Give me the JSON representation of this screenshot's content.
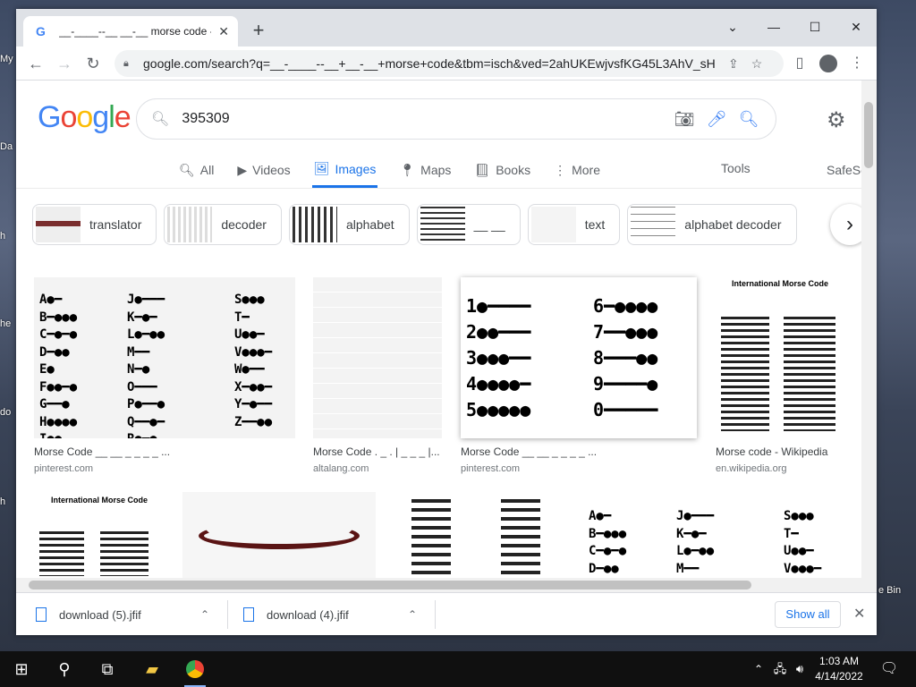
{
  "browser": {
    "tab_title": "__-____--__ __-__ morse code - Go",
    "url": "google.com/search?q=__-____--__+__-__+morse+code&tbm=isch&ved=2ahUKEwjvsfKG45L3AhV_sHIE..."
  },
  "search": {
    "logo": "Google",
    "query": "395309",
    "tabs": [
      "All",
      "Videos",
      "Images",
      "Maps",
      "Books",
      "More"
    ],
    "active_tab": "Images",
    "tools": "Tools",
    "safesearch": "SafeSe"
  },
  "chips": [
    "translator",
    "decoder",
    "alphabet",
    "__ __",
    "text",
    "alphabet decoder"
  ],
  "results": [
    {
      "title": "Morse Code __ __ _ _ _ _ ...",
      "source": "pinterest.com"
    },
    {
      "title": "Morse Code . _ . | _ _ _ |...",
      "source": "altalang.com"
    },
    {
      "title": "Morse Code __ __ _ _ _ _ ...",
      "source": "pinterest.com"
    },
    {
      "title": "Morse code - Wikipedia",
      "source": "en.wikipedia.org"
    }
  ],
  "morse_letters": {
    "col1": [
      "A●━",
      "B━●●●",
      "C━●━●",
      "D━●●",
      "E●",
      "F●●━●",
      "G━━●",
      "H●●●●",
      "I●●"
    ],
    "col2": [
      "J●━━━",
      "K━●━",
      "L●━●●",
      "M━━",
      "N━●",
      "O━━━",
      "P●━━●",
      "Q━━●━",
      "R●━●"
    ],
    "col3": [
      "S●●●",
      "T━",
      "U●●━",
      "V●●●━",
      "W●━━",
      "X━●●━",
      "Y━●━━",
      "Z━━●●"
    ]
  },
  "morse_digits": {
    "left": [
      "1●━━━━",
      "2●●━━━",
      "3●●●━━",
      "4●●●●━",
      "5●●●●●"
    ],
    "right": [
      "6━●●●●",
      "7━━●●●",
      "8━━━●●",
      "9━━━━●",
      "0━━━━━"
    ]
  },
  "wiki_heading": "International Morse Code",
  "downloads": [
    {
      "name": "download (5).jfif"
    },
    {
      "name": "download (4).jfif"
    }
  ],
  "show_all": "Show all",
  "clock": {
    "time": "1:03 AM",
    "date": "4/14/2022"
  },
  "desktop_fragments": [
    "My",
    "Da",
    "h",
    "he",
    "do",
    "h",
    "e Bin"
  ],
  "colors": {
    "accent": "#1a73e8",
    "google_blue": "#4285f4",
    "google_red": "#ea4335",
    "google_yellow": "#fbbc05",
    "google_green": "#34a853"
  }
}
